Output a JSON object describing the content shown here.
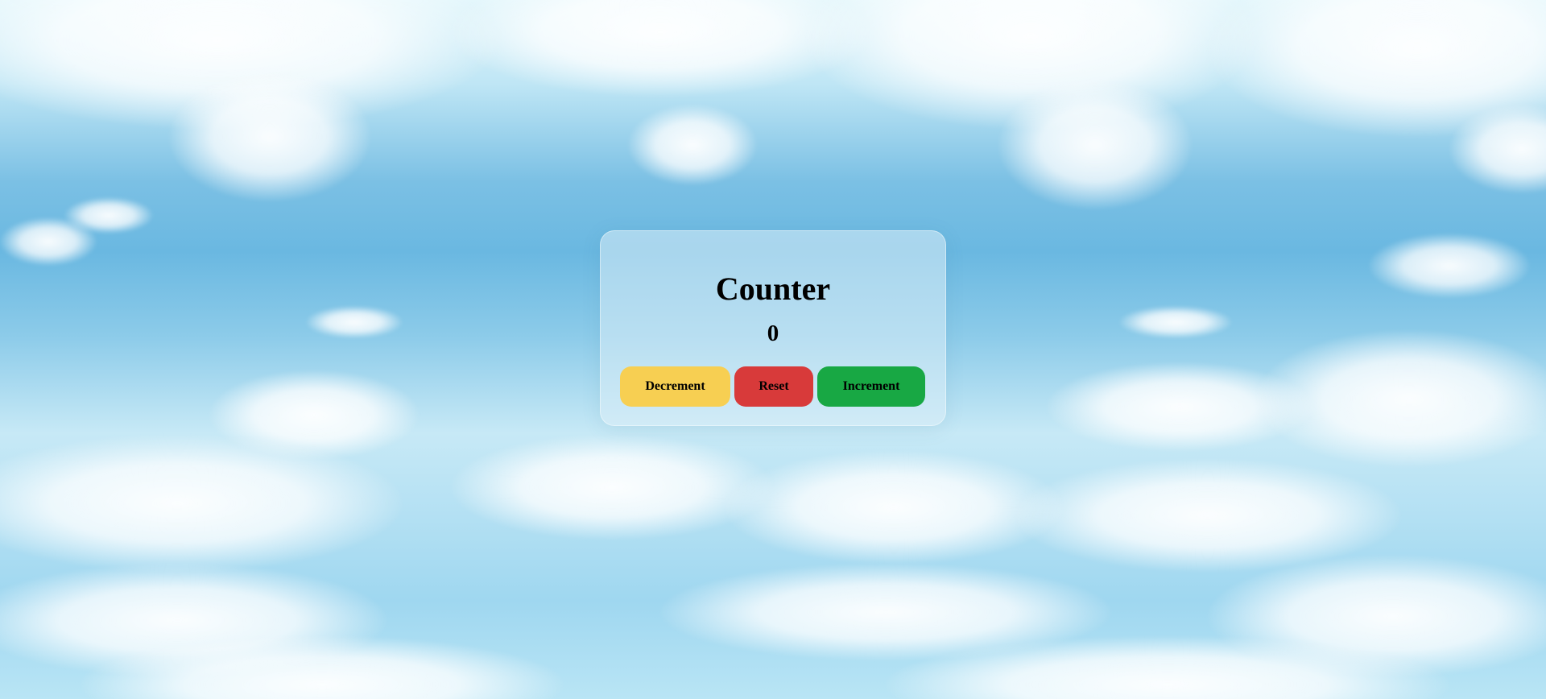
{
  "counter": {
    "title": "Counter",
    "value": "0"
  },
  "buttons": {
    "decrement": {
      "label": "Decrement",
      "color": "#f7cf52"
    },
    "reset": {
      "label": "Reset",
      "color": "#d83a3a"
    },
    "increment": {
      "label": "Increment",
      "color": "#18a844"
    }
  },
  "colors": {
    "sky": "#6ab8e1",
    "card": "#dceef8"
  }
}
